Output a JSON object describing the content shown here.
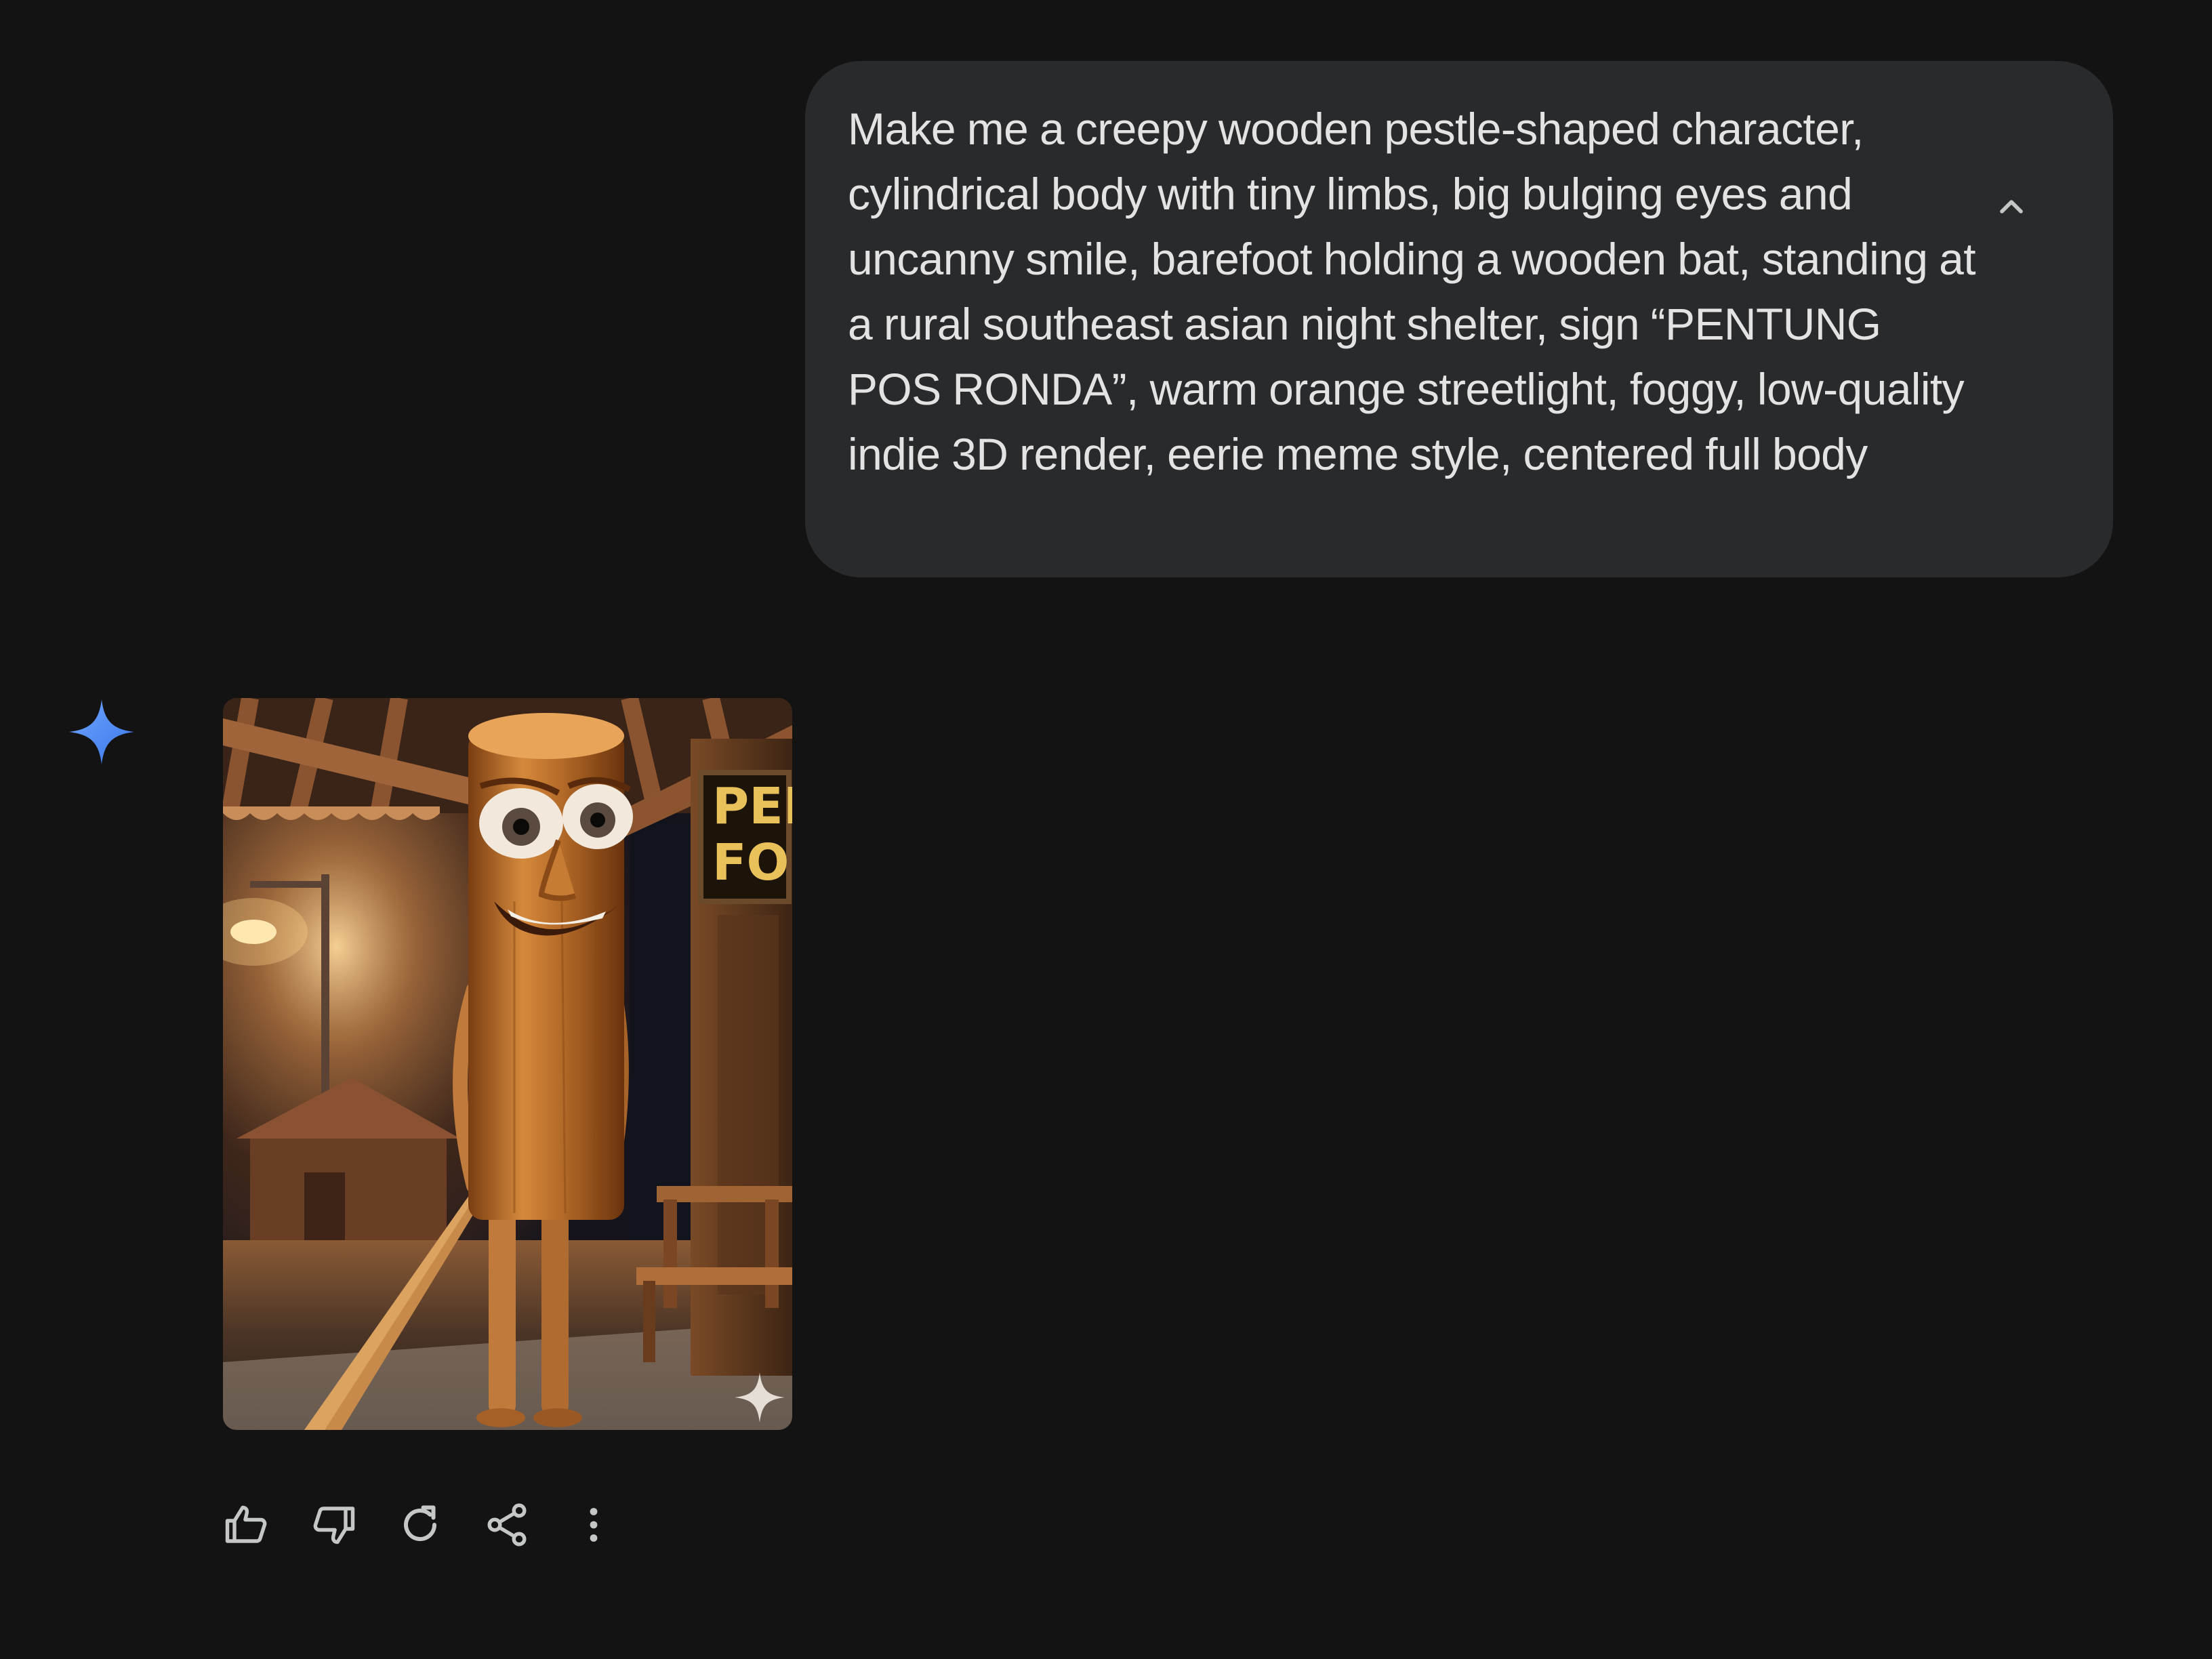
{
  "conversation": {
    "user_prompt": {
      "text": "Make me a creepy wooden pestle-shaped character, cylindrical body with tiny limbs, big bulging eyes and uncanny smile, barefoot holding a wooden bat, standing at a rural southeast asian night shelter, sign “PENTUNG POS RONDA”, warm orange streetlight, foggy, low-quality indie 3D render, eerie meme style, centered full body",
      "collapse_icon": "chevron-up-icon"
    },
    "response": {
      "avatar_icon": "gemini-sparkle-icon",
      "avatar_color": "#4c8df6",
      "image": {
        "sign_line_1": "PEN",
        "sign_line_2": "FOS",
        "watermark_icon": "sparkle-watermark-icon"
      },
      "actions": [
        {
          "icon": "thumbs-up-icon"
        },
        {
          "icon": "thumbs-down-icon"
        },
        {
          "icon": "regenerate-icon"
        },
        {
          "icon": "share-icon"
        },
        {
          "icon": "more-vertical-icon"
        }
      ]
    }
  },
  "colors": {
    "background": "#131314",
    "bubble": "#282a2c",
    "text": "#e3e3e3",
    "icon": "#c4c7c5"
  }
}
